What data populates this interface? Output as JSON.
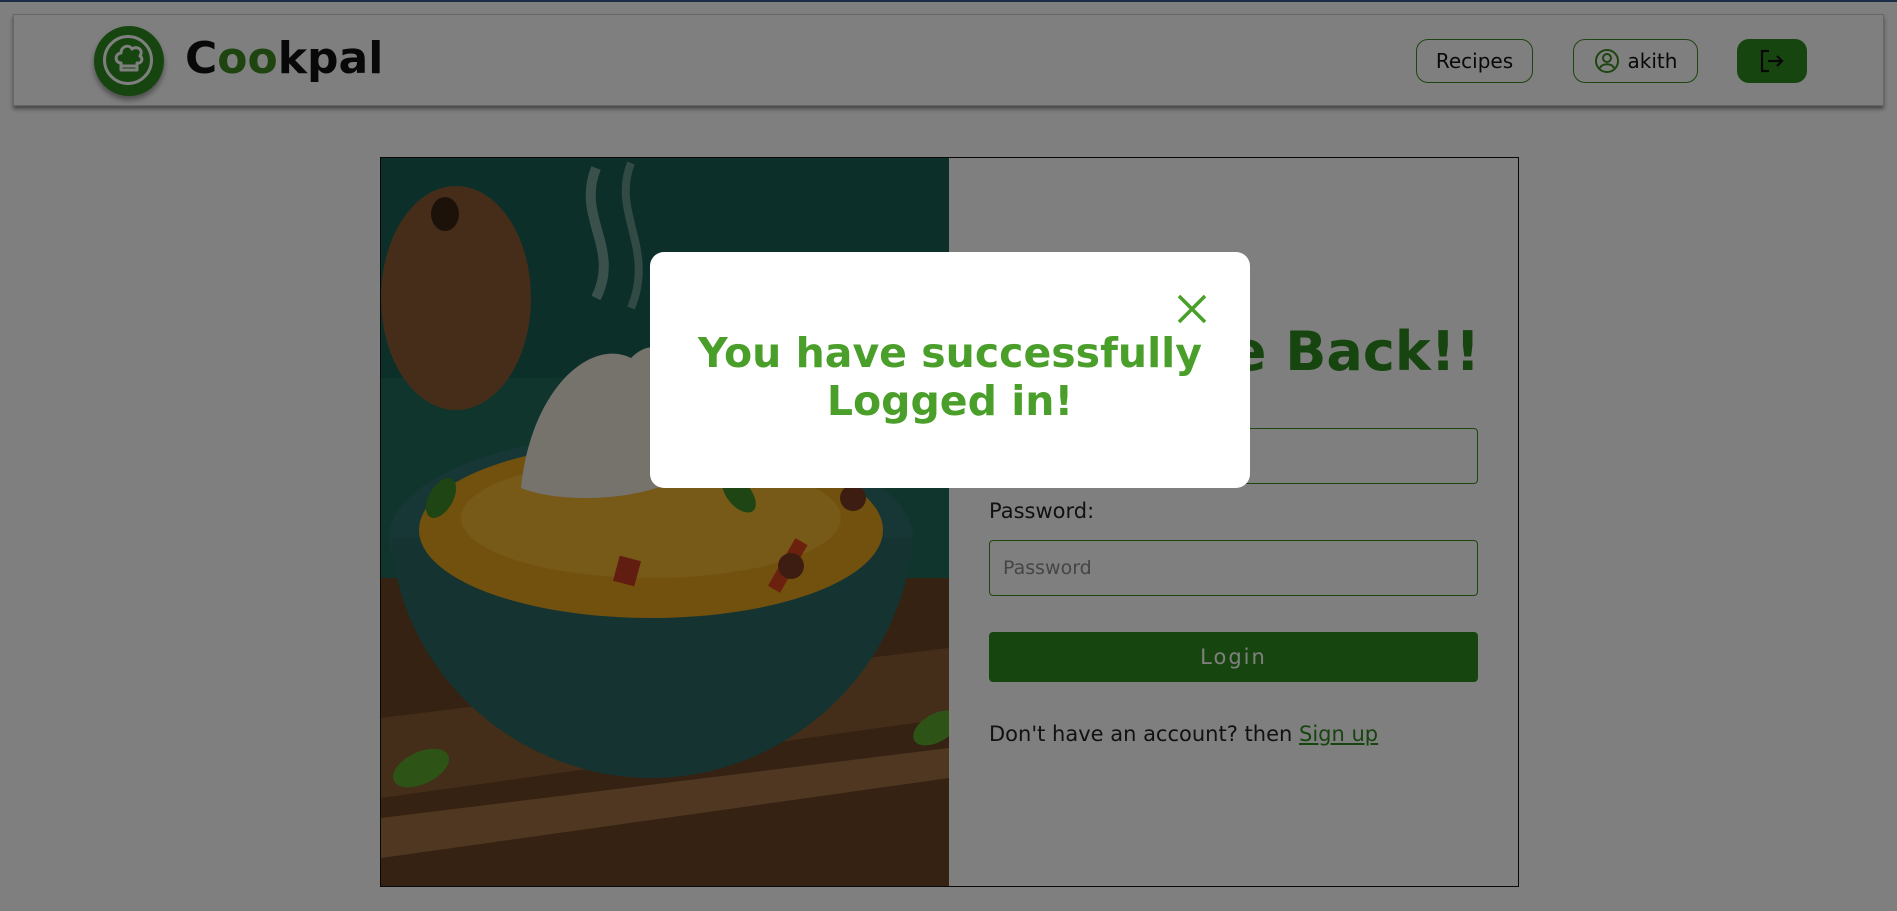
{
  "header": {
    "brand": {
      "part1": "C",
      "part2": "oo",
      "part3": "kpal"
    },
    "nav": {
      "recipes_label": "Recipes",
      "user_label": "akith"
    },
    "icons": {
      "logo": "chef-hat-icon",
      "user": "user-circle-icon",
      "logout": "logout-icon"
    }
  },
  "login": {
    "heading_visible": "e Back!!",
    "password_label": "Password:",
    "password_placeholder": "Password",
    "login_button": "Login",
    "signup_prompt": "Don't have an account? then ",
    "signup_link": "Sign up"
  },
  "modal": {
    "line1": "You have successfully",
    "line2": "Logged in!",
    "icon": "close-icon"
  },
  "colors": {
    "brand_green": "#2f8a1e",
    "modal_text": "#4a9e2a",
    "overlay": "rgba(0,0,0,0.5)"
  }
}
